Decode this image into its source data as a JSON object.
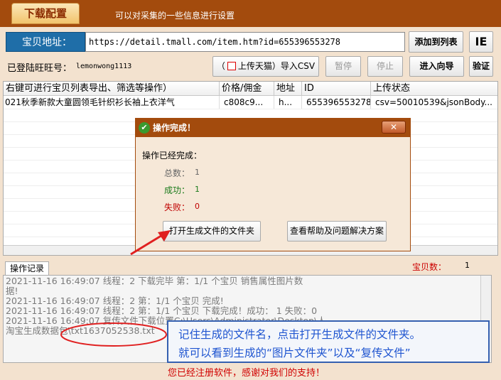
{
  "header": {
    "tab_label": "下载配置",
    "description": "可以对采集的一些信息进行设置"
  },
  "url_bar": {
    "label": "宝贝地址：",
    "value": "https://detail.tmall.com/item.htm?id=655396553278",
    "add_button": "添加到列表",
    "ie_button": "IE"
  },
  "toolbar": {
    "logged_label": "已登陆旺旺号：",
    "logged_user": "lemonwong1113",
    "upload_tmall_prefix": "（",
    "upload_tmall_label": "上传天猫",
    "upload_tmall_suffix": "）导入CSV",
    "pause_button": "暂停",
    "stop_button": "停止",
    "wizard_button": "进入向导",
    "verify_button": "验证"
  },
  "table": {
    "columns": [
      "右键可进行宝贝列表导出、筛选等操作）",
      "价格/佣金",
      "地址",
      "ID",
      "上传状态"
    ],
    "rows": [
      [
        "021秋季新款大童圆领毛针织衫长袖上衣洋气",
        "c808c9...",
        "h...",
        "655396553278",
        "csv=50010539&jsonBody..."
      ]
    ]
  },
  "dialog": {
    "title": "操作完成！",
    "close_label": "✕",
    "message": "操作已经完成：",
    "total_label": "总数：",
    "total_value": "1",
    "success_label": "成功：",
    "success_value": "1",
    "fail_label": "失败：",
    "fail_value": "0",
    "open_folder_button": "打开生成文件的文件夹",
    "help_button": "查看帮助及问题解决方案"
  },
  "log": {
    "tab_label": "操作记录",
    "count_label": "宝贝数：",
    "count_value": "1",
    "lines": [
      "2021-11-16 16:49:07 线程：2  下载完毕 第：1/1  个宝贝   销售属性图片数",
      "据!",
      "2021-11-16 16:49:07 线程：2 第：1/1 个宝贝 完成!",
      "2021-11-16 16:49:07 线程：2 第：1/1 个宝贝 下载完成！成功： 1 失败：0",
      "2021-11-16 16:49:07 复传文件下载位置C:\\Users\\Administrator\\Desktop\\人",
      "淘宝生成数据包\\txt1637052538.txt"
    ]
  },
  "annotation": {
    "line1": "记住生成的文件名，点击打开生成文件的文件夹。",
    "line2": "就可以看到生成的“图片文件夹”以及“复传文件”"
  },
  "footer": {
    "message": "您已经注册软件，感谢对我们的支持！"
  },
  "colors": {
    "header_bg": "#a34b0d",
    "url_label_bg": "#1f6ea8",
    "annotation_blue": "#1f55d0",
    "annotation_red": "#e02020",
    "success_green": "#1a7a1a",
    "fail_red": "#c00000"
  }
}
